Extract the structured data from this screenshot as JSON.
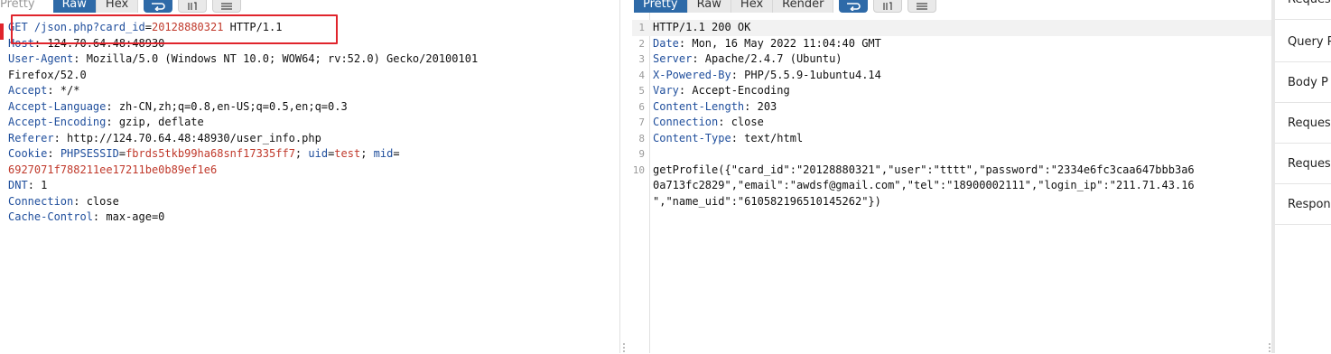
{
  "request": {
    "tabs": [
      "Pretty",
      "Raw",
      "Hex"
    ],
    "selected_tab": "Raw",
    "lines": [
      [
        [
          "k",
          "GET /json.php?"
        ],
        [
          "b",
          "card_id"
        ],
        [
          "v",
          "="
        ],
        [
          "r",
          "20128880321"
        ],
        [
          "v",
          " HTTP/1.1"
        ]
      ],
      [
        [
          "k",
          "Host"
        ],
        [
          "v",
          ": 124.70.64.48:48930"
        ]
      ],
      [
        [
          "k",
          "User-Agent"
        ],
        [
          "v",
          ": Mozilla/5.0 (Windows NT 10.0; WOW64; rv:52.0) Gecko/20100101"
        ]
      ],
      [
        [
          "v",
          "Firefox/52.0"
        ]
      ],
      [
        [
          "k",
          "Accept"
        ],
        [
          "v",
          ": */*"
        ]
      ],
      [
        [
          "k",
          "Accept-Language"
        ],
        [
          "v",
          ": zh-CN,zh;q=0.8,en-US;q=0.5,en;q=0.3"
        ]
      ],
      [
        [
          "k",
          "Accept-Encoding"
        ],
        [
          "v",
          ": gzip, deflate"
        ]
      ],
      [
        [
          "k",
          "Referer"
        ],
        [
          "v",
          ": http://124.70.64.48:48930/user_info.php"
        ]
      ],
      [
        [
          "k",
          "Cookie"
        ],
        [
          "v",
          ": "
        ],
        [
          "b",
          "PHPSESSID"
        ],
        [
          "v",
          "="
        ],
        [
          "r",
          "fbrds5tkb99ha68snf17335ff7"
        ],
        [
          "v",
          "; "
        ],
        [
          "b",
          "uid"
        ],
        [
          "v",
          "="
        ],
        [
          "r",
          "test"
        ],
        [
          "v",
          "; "
        ],
        [
          "b",
          "mid"
        ],
        [
          "v",
          "="
        ]
      ],
      [
        [
          "r",
          "6927071f788211ee17211be0b89ef1e6"
        ]
      ],
      [
        [
          "k",
          "DNT"
        ],
        [
          "v",
          ": 1"
        ]
      ],
      [
        [
          "k",
          "Connection"
        ],
        [
          "v",
          ": close"
        ]
      ],
      [
        [
          "k",
          "Cache-Control"
        ],
        [
          "v",
          ": max-age=0"
        ]
      ]
    ]
  },
  "response": {
    "tabs": [
      "Raw",
      "Hex",
      "Render"
    ],
    "selected_tab": "Pretty",
    "lines": [
      {
        "n": "1",
        "seg": [
          [
            "v",
            "HTTP/1.1 200 OK"
          ]
        ]
      },
      {
        "n": "2",
        "seg": [
          [
            "k",
            "Date"
          ],
          [
            "v",
            ": Mon, 16 May 2022 11:04:40 GMT"
          ]
        ]
      },
      {
        "n": "3",
        "seg": [
          [
            "k",
            "Server"
          ],
          [
            "v",
            ": Apache/2.4.7 (Ubuntu)"
          ]
        ]
      },
      {
        "n": "4",
        "seg": [
          [
            "k",
            "X-Powered-By"
          ],
          [
            "v",
            ": PHP/5.5.9-1ubuntu4.14"
          ]
        ]
      },
      {
        "n": "5",
        "seg": [
          [
            "k",
            "Vary"
          ],
          [
            "v",
            ": Accept-Encoding"
          ]
        ]
      },
      {
        "n": "6",
        "seg": [
          [
            "k",
            "Content-Length"
          ],
          [
            "v",
            ": 203"
          ]
        ]
      },
      {
        "n": "7",
        "seg": [
          [
            "k",
            "Connection"
          ],
          [
            "v",
            ": close"
          ]
        ]
      },
      {
        "n": "8",
        "seg": [
          [
            "k",
            "Content-Type"
          ],
          [
            "v",
            ": text/html"
          ]
        ]
      },
      {
        "n": "9",
        "seg": []
      },
      {
        "n": "10",
        "seg": [
          [
            "v",
            "getProfile({\"card_id\":\"20128880321\",\"user\":\"tttt\",\"password\":\"2334e6fc3caa647bbb3a6"
          ]
        ]
      },
      {
        "n": "",
        "seg": [
          [
            "v",
            "0a713fc2829\",\"email\":\"awdsf@gmail.com\",\"tel\":\"18900002111\",\"login_ip\":\"211.71.43.16"
          ]
        ]
      },
      {
        "n": "",
        "seg": [
          [
            "v",
            "\",\"name_uid\":\"610582196510145262\"})"
          ]
        ]
      }
    ]
  },
  "inspector": {
    "items": [
      "Reques",
      "Query P",
      "Body P",
      "Reques",
      "Reques",
      "Respon"
    ]
  }
}
